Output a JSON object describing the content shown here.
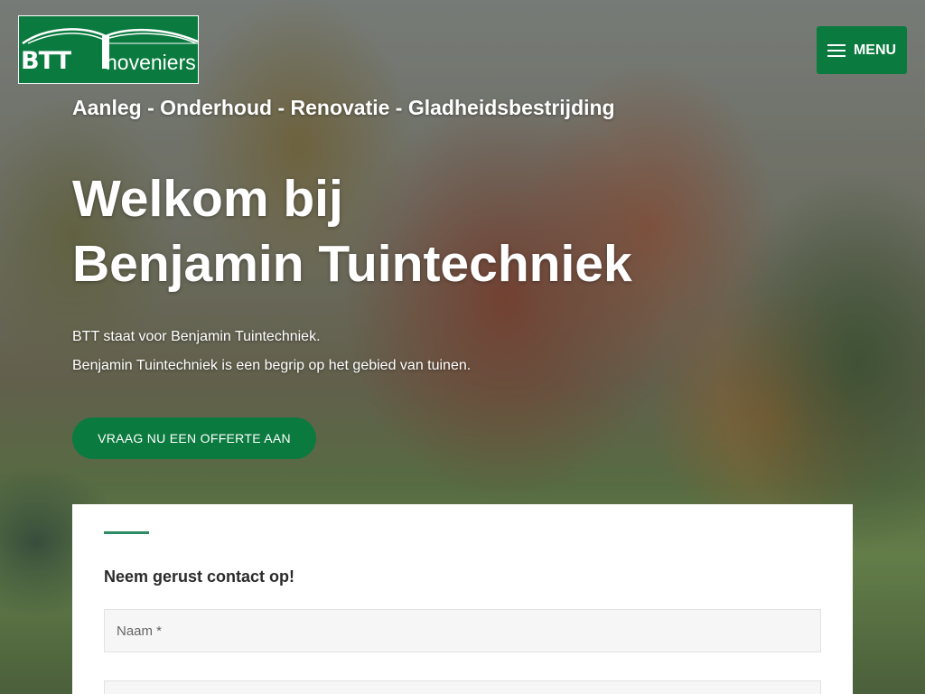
{
  "logo": {
    "mark": "BTT",
    "word": "hoveniers"
  },
  "header": {
    "menu_label": "MENU",
    "menu_icon": "hamburger-icon"
  },
  "hero": {
    "tagline": "Aanleg - Onderhoud - Renovatie - Gladheidsbestrijding",
    "title_line1": "Welkom bij",
    "title_line2": "Benjamin Tuintechniek",
    "text_line1": "BTT staat voor Benjamin Tuintechniek.",
    "text_line2": "Benjamin Tuintechniek is een begrip op het gebied van tuinen.",
    "cta_label": "VRAAG NU EEN OFFERTE AAN"
  },
  "contact": {
    "heading": "Neem gerust contact op!",
    "name_placeholder": "Naam *",
    "second_placeholder": ""
  },
  "colors": {
    "brand_green": "#0a7a3f",
    "accent_line": "#2f8a66",
    "card_bg": "#ffffff",
    "input_bg": "#f6f6f6"
  }
}
